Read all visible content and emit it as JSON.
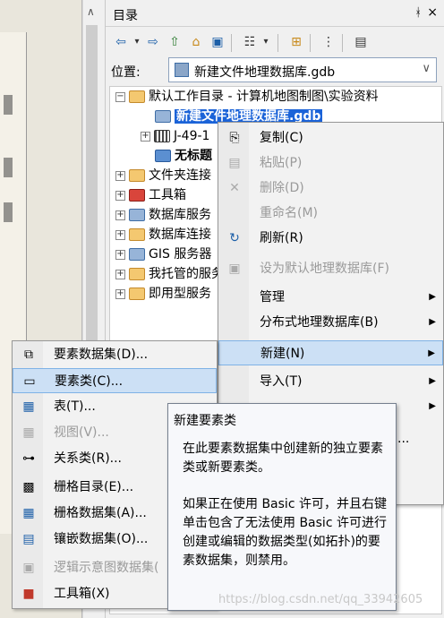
{
  "catalog": {
    "title": "目录",
    "pin": "ᚼ",
    "close": "×",
    "location_label": "位置:",
    "location_value": "新建文件地理数据库.gdb"
  },
  "toolbar": {
    "back": "⇦",
    "back_drop": "▾",
    "forward": "⇨",
    "up": "⇧",
    "home": "⌂",
    "connect": "▣",
    "view": "☷",
    "view_drop": "▾",
    "new_folder": "⊞",
    "options1": "⋮",
    "options2": "▤"
  },
  "tree": {
    "root": "默认工作目录 - 计算机地图制图\\实验资料",
    "selected": "新建文件地理数据库.gdb",
    "item_j": "J-49-1",
    "item_untitled": "无标题",
    "items": [
      "文件夹连接",
      "工具箱",
      "数据库服务",
      "数据库连接",
      "GIS 服务器",
      "我托管的服务",
      "即用型服务"
    ]
  },
  "context_menu": {
    "copy": "复制(C)",
    "paste": "粘贴(P)",
    "delete": "删除(D)",
    "rename": "重命名(M)",
    "refresh": "刷新(R)",
    "set_default": "设为默认地理数据库(F)",
    "manage": "管理",
    "distributed": "分布式地理数据库(B)",
    "new": "新建(N)",
    "import": "导入(T)",
    "more": "..."
  },
  "sub_menu": {
    "feature_dataset": "要素数据集(D)...",
    "feature_class": "要素类(C)...",
    "table": "表(T)...",
    "view": "视图(V)...",
    "relationship": "关系类(R)...",
    "raster_catalog": "栅格目录(E)...",
    "raster_dataset": "栅格数据集(A)...",
    "mosaic_dataset": "镶嵌数据集(O)...",
    "schematic": "逻辑示意图数据集(",
    "toolbox": "工具箱(X)"
  },
  "tooltip": {
    "title": "新建要素类",
    "p1": "在此要素数据集中创建新的独立要素类或新要素类。",
    "p2": "如果正在使用 Basic 许可，并且右键单击包含了无法使用 Basic 许可进行创建或编辑的数据类型(如拓扑)的要素数据集，则禁用。"
  },
  "watermark": "https://blog.csdn.net/qq_33942605",
  "scrollbar": {
    "up": "∧"
  },
  "location_chevron": "∨",
  "expanders": {
    "minus": "−",
    "plus": "+"
  },
  "submenu_arrow": "▶"
}
